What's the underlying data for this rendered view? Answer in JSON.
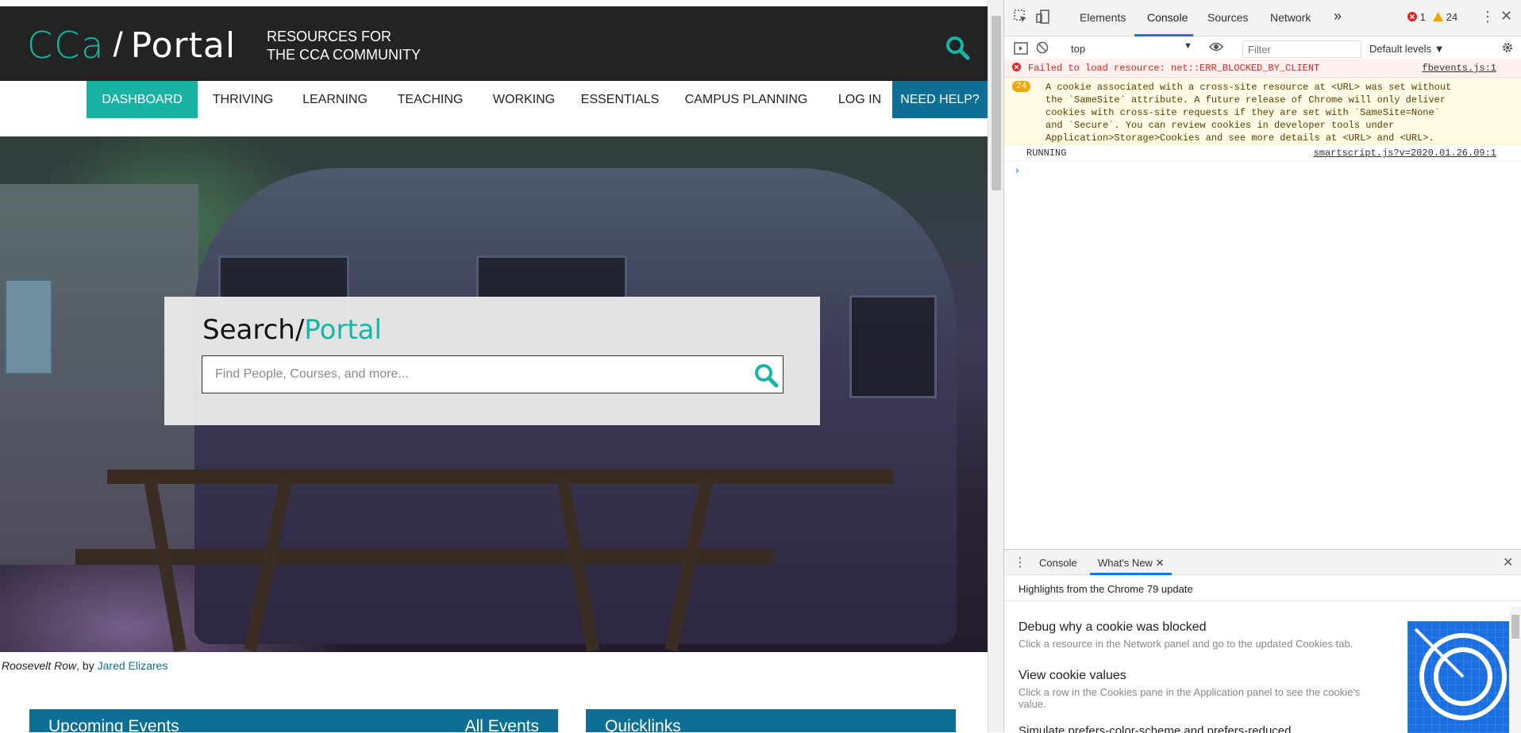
{
  "site": {
    "logo_mark": "CCa",
    "logo_slash": "/",
    "logo_portal": "Portal",
    "tagline_line1": "RESOURCES FOR",
    "tagline_line2": "THE CCA COMMUNITY"
  },
  "nav": {
    "items": [
      "DASHBOARD",
      "THRIVING",
      "LEARNING",
      "TEACHING",
      "WORKING",
      "ESSENTIALS",
      "CAMPUS PLANNING",
      "LOG IN",
      "NEED HELP?"
    ],
    "active": "DASHBOARD"
  },
  "search": {
    "title_black": "Search",
    "title_slash": "/",
    "title_teal": "Portal",
    "placeholder": "Find People, Courses, and more..."
  },
  "caption": {
    "title": "Roosevelt Row",
    "by": ", by ",
    "author": "Jared Elizares"
  },
  "sections": {
    "events_title": "Upcoming Events",
    "events_link": "All Events",
    "quicklinks_title": "Quicklinks"
  },
  "devtools": {
    "tabs": [
      "Elements",
      "Console",
      "Sources",
      "Network"
    ],
    "more": "»",
    "active_tab": "Console",
    "error_count": "1",
    "warning_count": "24",
    "context": "top",
    "filter_placeholder": "Filter",
    "levels": "Default levels",
    "logs": {
      "error_text": "Failed to load resource: net::ERR_BLOCKED_BY_CLIENT",
      "error_source": "fbevents.js:1",
      "warn_badge": "24",
      "warn_lines": [
        "A cookie associated with a cross-site resource at <URL> was set without",
        "the `SameSite` attribute. A future release of Chrome will only deliver",
        "cookies with cross-site requests if they are set with `SameSite=None`",
        "and `Secure`. You can review cookies in developer tools under",
        "Application>Storage>Cookies and see more details at <URL> and <URL>."
      ],
      "run_text": "RUNNING",
      "run_source": "smartscript.js?v=2020.01.26.09:1",
      "prompt": "›"
    },
    "drawer": {
      "tabs": [
        "Console",
        "What's New"
      ],
      "active": "What's New",
      "heading": "Highlights from the Chrome 79 update",
      "items": [
        {
          "title": "Debug why a cookie was blocked",
          "desc": "Click a resource in the Network panel and go to the updated Cookies tab."
        },
        {
          "title": "View cookie values",
          "desc": "Click a row in the Cookies pane in the Application panel to see the cookie's value."
        },
        {
          "title": "Simulate prefers-color-scheme and prefers-reduced",
          "desc": ""
        }
      ]
    }
  }
}
